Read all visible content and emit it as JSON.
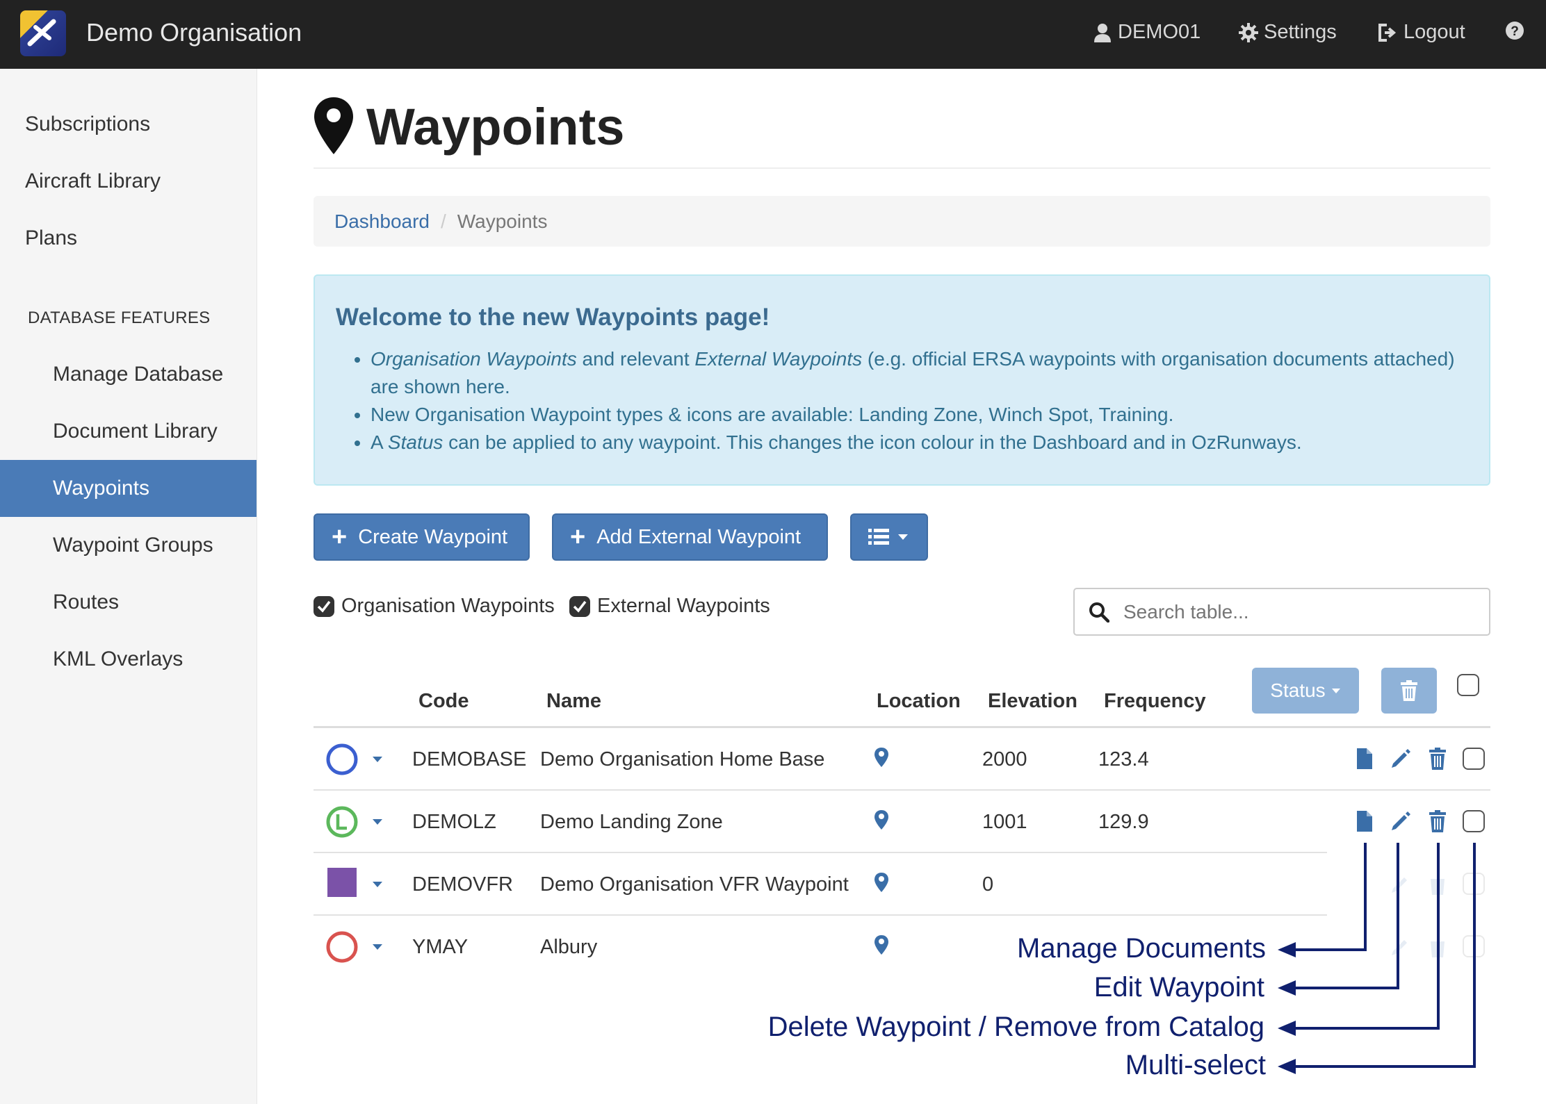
{
  "header": {
    "brand": "Demo Organisation",
    "user": "DEMO01",
    "settings": "Settings",
    "logout": "Logout"
  },
  "sidebar": {
    "items": [
      {
        "label": "Subscriptions"
      },
      {
        "label": "Aircraft Library"
      },
      {
        "label": "Plans"
      }
    ],
    "section_header": "DATABASE FEATURES",
    "db_items": [
      {
        "label": "Manage Database"
      },
      {
        "label": "Document Library"
      },
      {
        "label": "Waypoints",
        "active": true
      },
      {
        "label": "Waypoint Groups"
      },
      {
        "label": "Routes"
      },
      {
        "label": "KML Overlays"
      }
    ]
  },
  "page": {
    "title": "Waypoints",
    "breadcrumb": {
      "home": "Dashboard",
      "current": "Waypoints"
    }
  },
  "alert": {
    "title": "Welcome to the new Waypoints page!",
    "b1_em1": "Organisation Waypoints",
    "b1_t1": " and relevant ",
    "b1_em2": "External Waypoints",
    "b1_t2": " (e.g. official ERSA waypoints with organisation documents attached) are shown here.",
    "b2": "New Organisation Waypoint types & icons are available: Landing Zone, Winch Spot, Training.",
    "b3_t1": "A ",
    "b3_em": "Status",
    "b3_t2": " can be applied to any waypoint. This changes the icon colour in the Dashboard and in OzRunways."
  },
  "toolbar": {
    "create": "Create Waypoint",
    "add_external": "Add External Waypoint"
  },
  "filters": {
    "org": "Organisation Waypoints",
    "ext": "External Waypoints"
  },
  "search": {
    "placeholder": "Search table..."
  },
  "table": {
    "columns": {
      "code": "Code",
      "name": "Name",
      "location": "Location",
      "elevation": "Elevation",
      "frequency": "Frequency"
    },
    "status_label": "Status",
    "rows": [
      {
        "icon": "blue-circle",
        "code": "DEMOBASE",
        "name": "Demo Organisation Home Base",
        "elevation": "2000",
        "frequency": "123.4"
      },
      {
        "icon": "green-landing-zone",
        "code": "DEMOLZ",
        "name": "Demo Landing Zone",
        "elevation": "1001",
        "frequency": "129.9",
        "icon_letter": "L"
      },
      {
        "icon": "purple-square",
        "code": "DEMOVFR",
        "name": "Demo Organisation VFR Waypoint",
        "elevation": "0",
        "frequency": ""
      },
      {
        "icon": "red-circle",
        "code": "YMAY",
        "name": "Albury",
        "elevation": "",
        "frequency": ""
      }
    ]
  },
  "annotations": {
    "docs": "Manage Documents",
    "edit": "Edit Waypoint",
    "delete": "Delete Waypoint / Remove from Catalog",
    "multi": "Multi-select"
  },
  "colors": {
    "nav_bg": "#222222",
    "primary": "#4a7bb7",
    "annotation": "#10206e",
    "row_blue": "#3b5fd0",
    "row_green": "#5cb85c",
    "row_purple": "#7b52a8",
    "row_red": "#d9534f"
  }
}
